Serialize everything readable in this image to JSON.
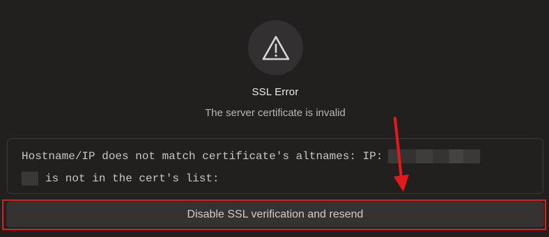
{
  "error": {
    "icon": "warning-triangle-icon",
    "title": "SSL Error",
    "subtitle": "The server certificate is invalid",
    "detail_line1": "Hostname/IP does not match certificate's altnames: IP:",
    "detail_line2": "is not in the cert's list:"
  },
  "actions": {
    "resend_label": "Disable SSL verification and resend"
  },
  "colors": {
    "background": "#221f1f",
    "highlight": "#e3191b",
    "button": "#353232"
  }
}
